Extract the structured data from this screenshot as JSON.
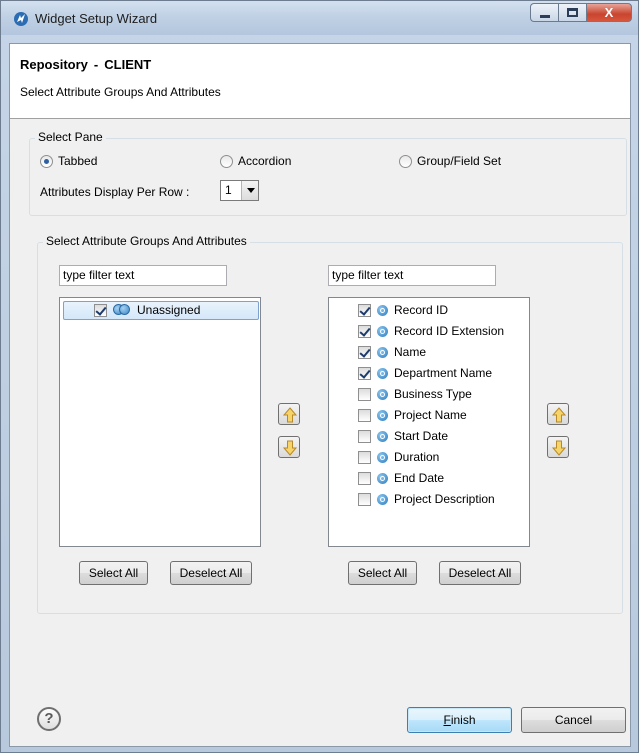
{
  "window": {
    "title": "Widget Setup Wizard",
    "close_glyph": "X"
  },
  "header": {
    "title_repository": "Repository",
    "title_separator": "-",
    "title_client": "CLIENT",
    "subtitle": "Select Attribute Groups And Attributes"
  },
  "select_pane": {
    "legend": "Select Pane",
    "options": [
      {
        "label": "Tabbed",
        "selected": true
      },
      {
        "label": "Accordion",
        "selected": false
      },
      {
        "label": "Group/Field Set",
        "selected": false
      }
    ],
    "per_row_label": "Attributes Display Per Row :",
    "per_row_value": "1"
  },
  "attributes_group": {
    "legend": "Select Attribute Groups And Attributes",
    "left": {
      "filter_text": "type filter text",
      "items": [
        {
          "label": "Unassigned",
          "checked": true,
          "icon": "attribute-group-icon"
        }
      ],
      "select_all": "Select All",
      "deselect_all": "Deselect All"
    },
    "right": {
      "filter_text": "type filter text",
      "items": [
        {
          "label": "Record ID",
          "checked": true
        },
        {
          "label": "Record ID Extension",
          "checked": true
        },
        {
          "label": "Name",
          "checked": true
        },
        {
          "label": "Department Name",
          "checked": true
        },
        {
          "label": "Business Type",
          "checked": false
        },
        {
          "label": "Project Name",
          "checked": false
        },
        {
          "label": "Start Date",
          "checked": false
        },
        {
          "label": "Duration",
          "checked": false
        },
        {
          "label": "End Date",
          "checked": false
        },
        {
          "label": "Project Description",
          "checked": false
        }
      ],
      "select_all": "Select All",
      "deselect_all": "Deselect All"
    },
    "move_up_icon": "arrow-up-icon",
    "move_down_icon": "arrow-down-icon"
  },
  "footer": {
    "help_glyph": "?",
    "finish_mnemonic": "F",
    "finish_rest": "inish",
    "cancel": "Cancel"
  },
  "colors": {
    "title_bar": "#bfd0e4",
    "dialog_bg": "#f0f0f0",
    "default_button": "#bee6fd",
    "close_button": "#c8452f"
  }
}
